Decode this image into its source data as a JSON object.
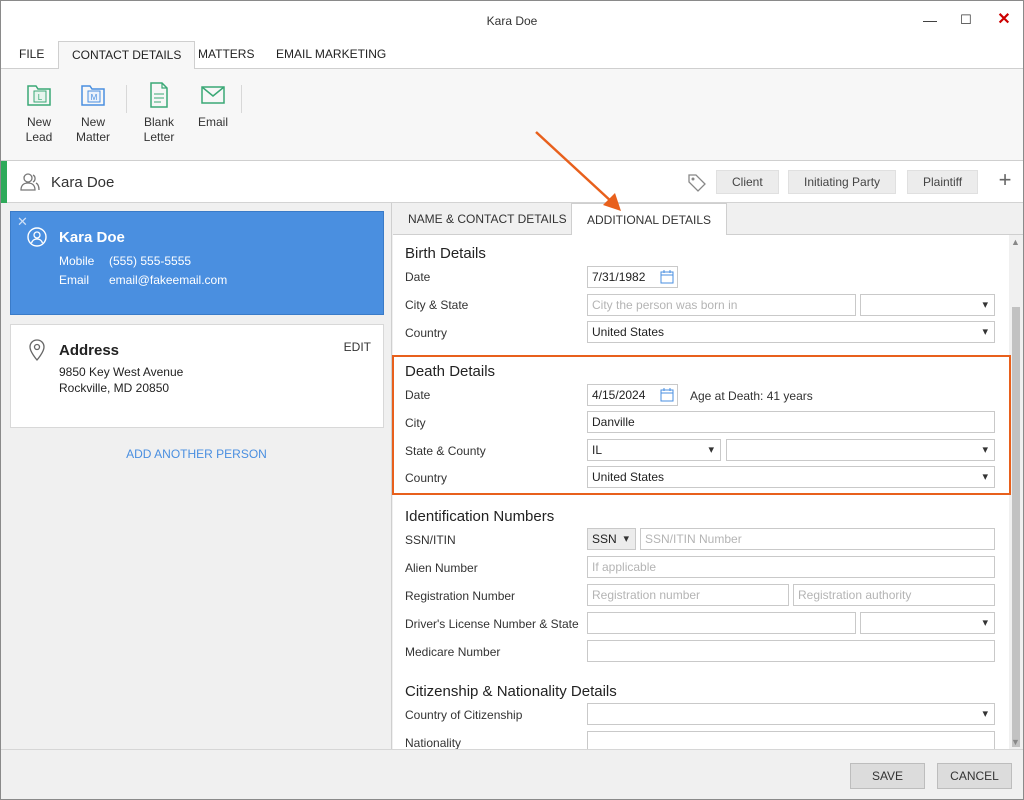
{
  "window": {
    "title": "Kara Doe",
    "minimize_glyph": "—",
    "maximize_glyph": "☐",
    "close_glyph": "✕"
  },
  "menu": {
    "tabs": [
      "FILE",
      "CONTACT DETAILS",
      "MATTERS",
      "EMAIL MARKETING"
    ],
    "active": "CONTACT DETAILS"
  },
  "ribbon": {
    "buttons": [
      {
        "line1": "New",
        "line2": "Lead",
        "icon": "new-lead-icon"
      },
      {
        "line1": "New",
        "line2": "Matter",
        "icon": "new-matter-icon"
      },
      {
        "line1": "Blank",
        "line2": "Letter",
        "icon": "blank-letter-icon"
      },
      {
        "line1": "Email",
        "line2": "",
        "icon": "email-icon"
      }
    ]
  },
  "header": {
    "name": "Kara Doe",
    "roles": [
      "Client",
      "Initiating Party",
      "Plaintiff"
    ],
    "add_glyph": "+"
  },
  "person_card": {
    "remove_glyph": "✕",
    "name": "Kara Doe",
    "mobile_label": "Mobile",
    "mobile": "(555) 555-5555",
    "email_label": "Email",
    "email": "email@fakeemail.com"
  },
  "address_card": {
    "title": "Address",
    "edit_label": "EDIT",
    "line1": "9850 Key West Avenue",
    "line2": "Rockville, MD 20850"
  },
  "add_person_label": "ADD ANOTHER PERSON",
  "detail_tabs": [
    "NAME & CONTACT DETAILS",
    "ADDITIONAL DETAILS"
  ],
  "birth": {
    "section": "Birth Details",
    "date_label": "Date",
    "date": "7/31/1982",
    "city_state_label": "City & State",
    "city_placeholder": "City the person was born in",
    "country_label": "Country",
    "country": "United States"
  },
  "death": {
    "section": "Death Details",
    "date_label": "Date",
    "date": "4/15/2024",
    "age_text": "Age at Death: 41 years",
    "city_label": "City",
    "city": "Danville",
    "state_county_label": "State & County",
    "state": "IL",
    "country_label": "Country",
    "country": "United States"
  },
  "identification": {
    "section": "Identification Numbers",
    "ssn_label": "SSN/ITIN",
    "ssn_type": "SSN",
    "ssn_placeholder": "SSN/ITIN Number",
    "alien_label": "Alien Number",
    "alien_placeholder": "If applicable",
    "registration_label": "Registration Number",
    "registration_placeholder": "Registration number",
    "authority_placeholder": "Registration authority",
    "license_label": "Driver's License Number & State",
    "medicare_label": "Medicare Number"
  },
  "citizenship": {
    "section": "Citizenship & Nationality Details",
    "country_label": "Country of Citizenship",
    "nationality_label": "Nationality"
  },
  "footer": {
    "save": "SAVE",
    "cancel": "CANCEL"
  },
  "colors": {
    "accent_blue": "#4a8fe0",
    "accent_green": "#2eaa5a",
    "highlight_orange": "#e8601c"
  }
}
